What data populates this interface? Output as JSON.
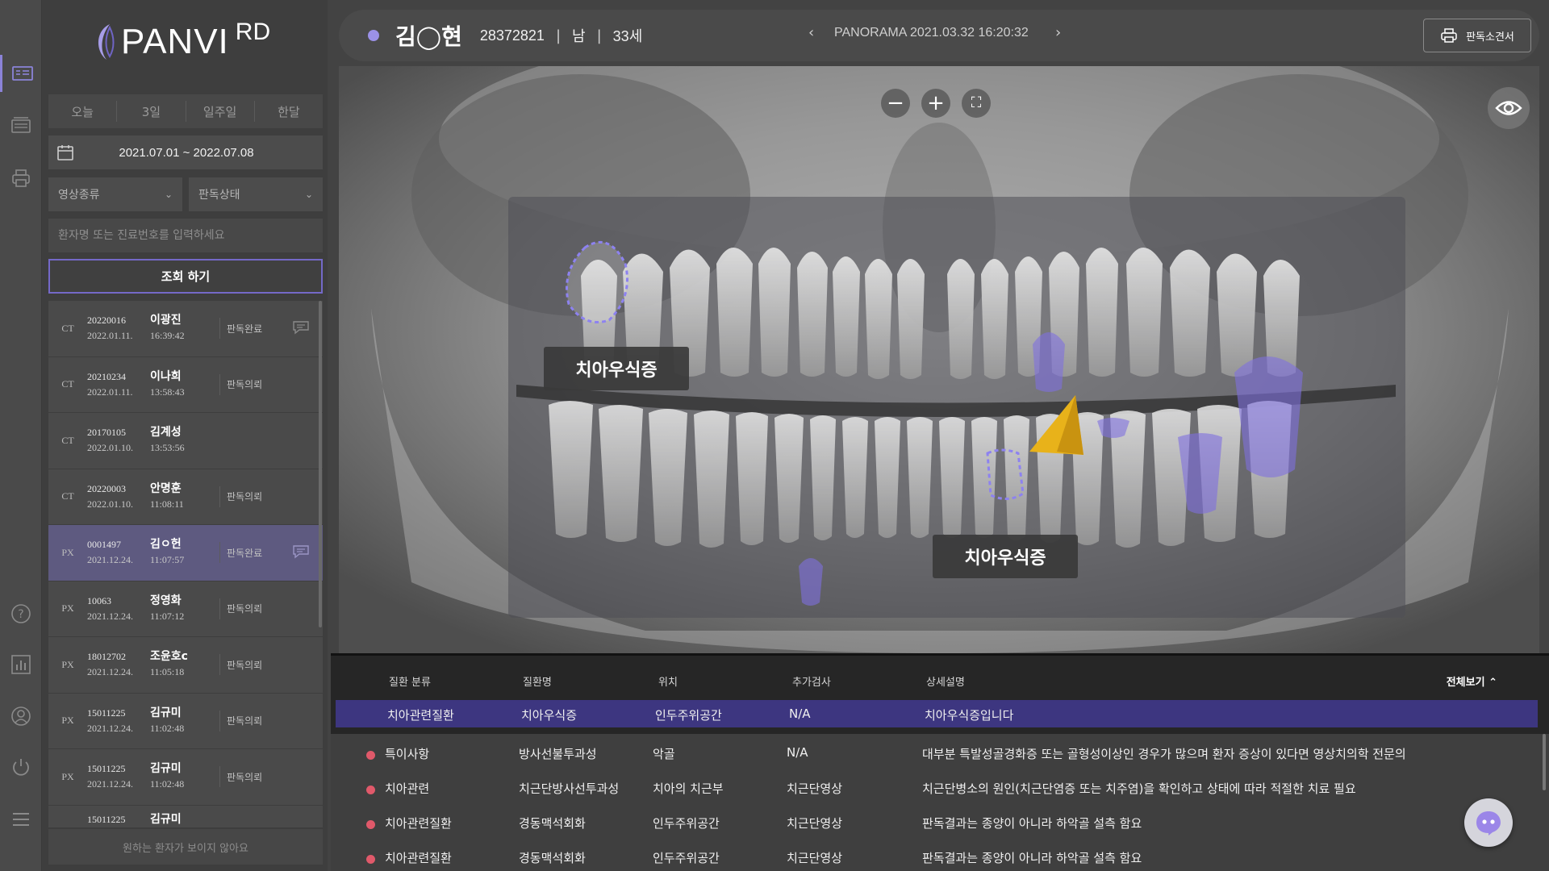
{
  "app": {
    "logo_text": "PANVI",
    "logo_sup": "RD"
  },
  "sidebar": {
    "period_tabs": [
      "오늘",
      "3일",
      "일주일",
      "한달"
    ],
    "date_range": "2021.07.01 ~ 2022.07.08",
    "image_type_label": "영상종류",
    "reading_status_label": "판독상태",
    "search_placeholder": "환자명 또는 진료번호를 입력하세요",
    "query_button": "조회 하기",
    "not_found_text": "원하는 환자가 보이지 않아요",
    "patients": [
      {
        "modality": "CT",
        "id": "20220016",
        "date": "2022.01.11.",
        "name": "이광진",
        "time": "16:39:42",
        "status": "판독완료",
        "comment": true
      },
      {
        "modality": "CT",
        "id": "20210234",
        "date": "2022.01.11.",
        "name": "이나희",
        "time": "13:58:43",
        "status": "판독의뢰",
        "comment": false
      },
      {
        "modality": "CT",
        "id": "20170105",
        "date": "2022.01.10.",
        "name": "김계성",
        "time": "13:53:56",
        "status": "",
        "comment": false
      },
      {
        "modality": "CT",
        "id": "20220003",
        "date": "2022.01.10.",
        "name": "안명훈",
        "time": "11:08:11",
        "status": "판독의뢰",
        "comment": false
      },
      {
        "modality": "PX",
        "id": "0001497",
        "date": "2021.12.24.",
        "name": "김ㅇ헌",
        "time": "11:07:57",
        "status": "판독완료",
        "comment": true,
        "selected": true
      },
      {
        "modality": "PX",
        "id": "10063",
        "date": "2021.12.24.",
        "name": "정영화",
        "time": "11:07:12",
        "status": "판독의뢰",
        "comment": false
      },
      {
        "modality": "PX",
        "id": "18012702",
        "date": "2021.12.24.",
        "name": "조윤호c",
        "time": "11:05:18",
        "status": "판독의뢰",
        "comment": false
      },
      {
        "modality": "PX",
        "id": "15011225",
        "date": "2021.12.24.",
        "name": "김규미",
        "time": "11:02:48",
        "status": "판독의뢰",
        "comment": false
      },
      {
        "modality": "PX",
        "id": "15011225",
        "date": "2021.12.24.",
        "name": "김규미",
        "time": "11:02:48",
        "status": "판독의뢰",
        "comment": false
      },
      {
        "modality": "",
        "id": "15011225",
        "date": "",
        "name": "김규미",
        "time": "",
        "status": "",
        "comment": false
      }
    ]
  },
  "header": {
    "patient_name": "김◯현",
    "patient_id": "28372821",
    "sex": "남",
    "age": "33세",
    "study": "PANORAMA 2021.03.32 16:20:32",
    "report_button": "판독소견서"
  },
  "viewer": {
    "callouts": [
      "치아우식증",
      "치아우식증"
    ]
  },
  "findings": {
    "columns": [
      "질환 분류",
      "질환명",
      "위치",
      "추가검사",
      "상세설명"
    ],
    "view_all": "전체보기",
    "rows": [
      {
        "category": "치아관련질환",
        "disease": "치아우식증",
        "location": "인두주위공간",
        "extra": "N/A",
        "detail": "치아우식증입니다",
        "selected": true
      },
      {
        "category": "특이사항",
        "disease": "방사선불투과성",
        "location": "악골",
        "extra": "N/A",
        "detail": "대부분 특발성골경화증 또는 골형성이상인 경우가 많으며 환자 증상이 있다면 영상치의학 전문의"
      },
      {
        "category": "치아관련",
        "disease": "치근단방사선투과성",
        "location": "치아의 치근부",
        "extra": "치근단영상",
        "detail": "치근단병소의 원인(치근단염증 또는 치주염)을 확인하고 상태에 따라 적절한 치료 필요"
      },
      {
        "category": "치아관련질환",
        "disease": "경동맥석회화",
        "location": "인두주위공간",
        "extra": "치근단영상",
        "detail": "판독결과는 종양이 아니라 하악골 설측 함요"
      },
      {
        "category": "치아관련질환",
        "disease": "경동맥석회화",
        "location": "인두주위공간",
        "extra": "치근단영상",
        "detail": "판독결과는 종양이 아니라 하악골 설측 함요"
      }
    ]
  },
  "colors": {
    "accent": "#8b83d8",
    "selected_row": "#3d3680",
    "finding_dot": "#e0596a",
    "caries_highlight": "#7f6fe0",
    "arrow": "#e8b21a"
  },
  "icons": {
    "rail": [
      "reading-list-icon",
      "gallery-icon",
      "print-icon",
      "help-icon",
      "stats-icon",
      "profile-icon",
      "power-icon",
      "menu-icon"
    ]
  }
}
